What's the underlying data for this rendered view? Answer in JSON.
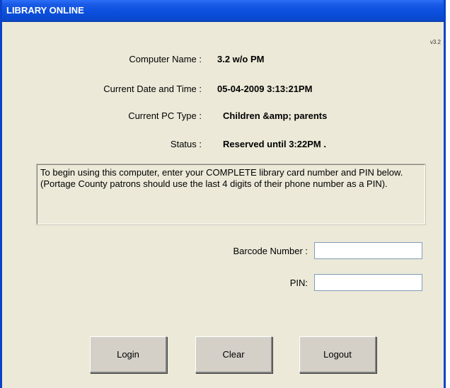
{
  "window": {
    "title": "LIBRARY ONLINE",
    "version": "v3.2"
  },
  "info": [
    {
      "label": "Computer Name :",
      "value": "3.2 w/o PM"
    },
    {
      "label": "Current Date and Time :",
      "value": "05-04-2009 3:13:21PM"
    },
    {
      "label": "Current PC Type :",
      "value": "Children &amp; parents"
    },
    {
      "label": "Status :",
      "value": "Reserved until 3:22PM ."
    }
  ],
  "instructions": {
    "text": "To begin using this computer, enter your COMPLETE library card number and PIN below.    (Portage County patrons should use the last 4 digits of their phone number as a PIN)."
  },
  "form": {
    "barcode_label": "Barcode Number :",
    "barcode_value": "",
    "pin_label": "PIN:",
    "pin_value": ""
  },
  "buttons": {
    "login": "Login",
    "clear": "Clear",
    "logout": "Logout"
  },
  "colors": {
    "titlebar": "#0a4fdc",
    "background": "#ece9d8",
    "button_face": "#d4d0c8"
  }
}
